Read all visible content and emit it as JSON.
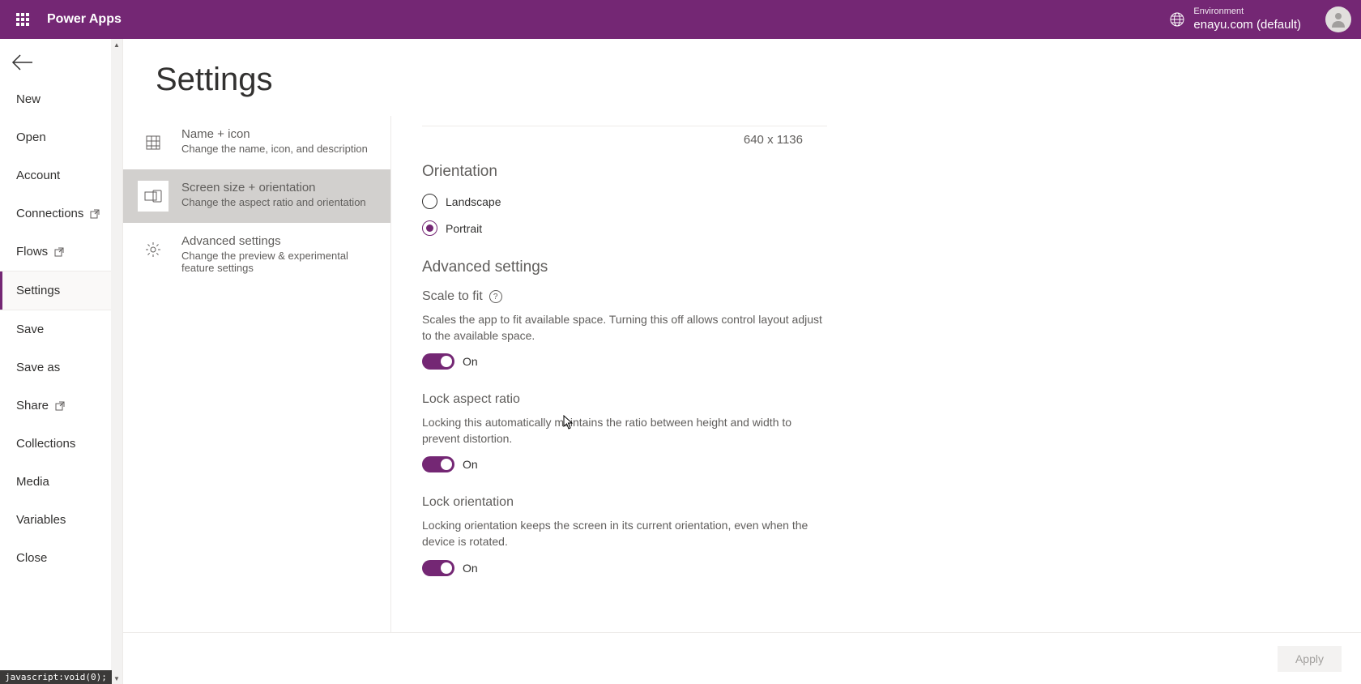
{
  "header": {
    "brand": "Power Apps",
    "env_label": "Environment",
    "env_name": "enayu.com (default)"
  },
  "sidebar": {
    "items": [
      {
        "label": "New",
        "popout": false
      },
      {
        "label": "Open",
        "popout": false
      },
      {
        "label": "Account",
        "popout": false
      },
      {
        "label": "Connections",
        "popout": true
      },
      {
        "label": "Flows",
        "popout": true
      },
      {
        "label": "Settings",
        "popout": false,
        "active": true
      },
      {
        "label": "Save",
        "popout": false
      },
      {
        "label": "Save as",
        "popout": false
      },
      {
        "label": "Share",
        "popout": true
      },
      {
        "label": "Collections",
        "popout": false
      },
      {
        "label": "Media",
        "popout": false
      },
      {
        "label": "Variables",
        "popout": false
      },
      {
        "label": "Close",
        "popout": false
      }
    ]
  },
  "page": {
    "title": "Settings"
  },
  "tabs": [
    {
      "title": "Name + icon",
      "desc": "Change the name, icon, and description"
    },
    {
      "title": "Screen size + orientation",
      "desc": "Change the aspect ratio and orientation"
    },
    {
      "title": "Advanced settings",
      "desc": "Change the preview & experimental feature settings"
    }
  ],
  "panel": {
    "dimensions": "640 x 1136",
    "orientation": {
      "heading": "Orientation",
      "options": [
        {
          "label": "Landscape",
          "checked": false
        },
        {
          "label": "Portrait",
          "checked": true
        }
      ]
    },
    "advanced_heading": "Advanced settings",
    "scale_to_fit": {
      "title": "Scale to fit",
      "desc": "Scales the app to fit available space. Turning this off allows control layout adjust to the available space.",
      "state": "On"
    },
    "lock_aspect": {
      "title": "Lock aspect ratio",
      "desc": "Locking this automatically maintains the ratio between height and width to prevent distortion.",
      "state": "On"
    },
    "lock_orientation": {
      "title": "Lock orientation",
      "desc": "Locking orientation keeps the screen in its current orientation, even when the device is rotated.",
      "state": "On"
    }
  },
  "footer": {
    "apply": "Apply"
  },
  "status_bar": "javascript:void(0);"
}
